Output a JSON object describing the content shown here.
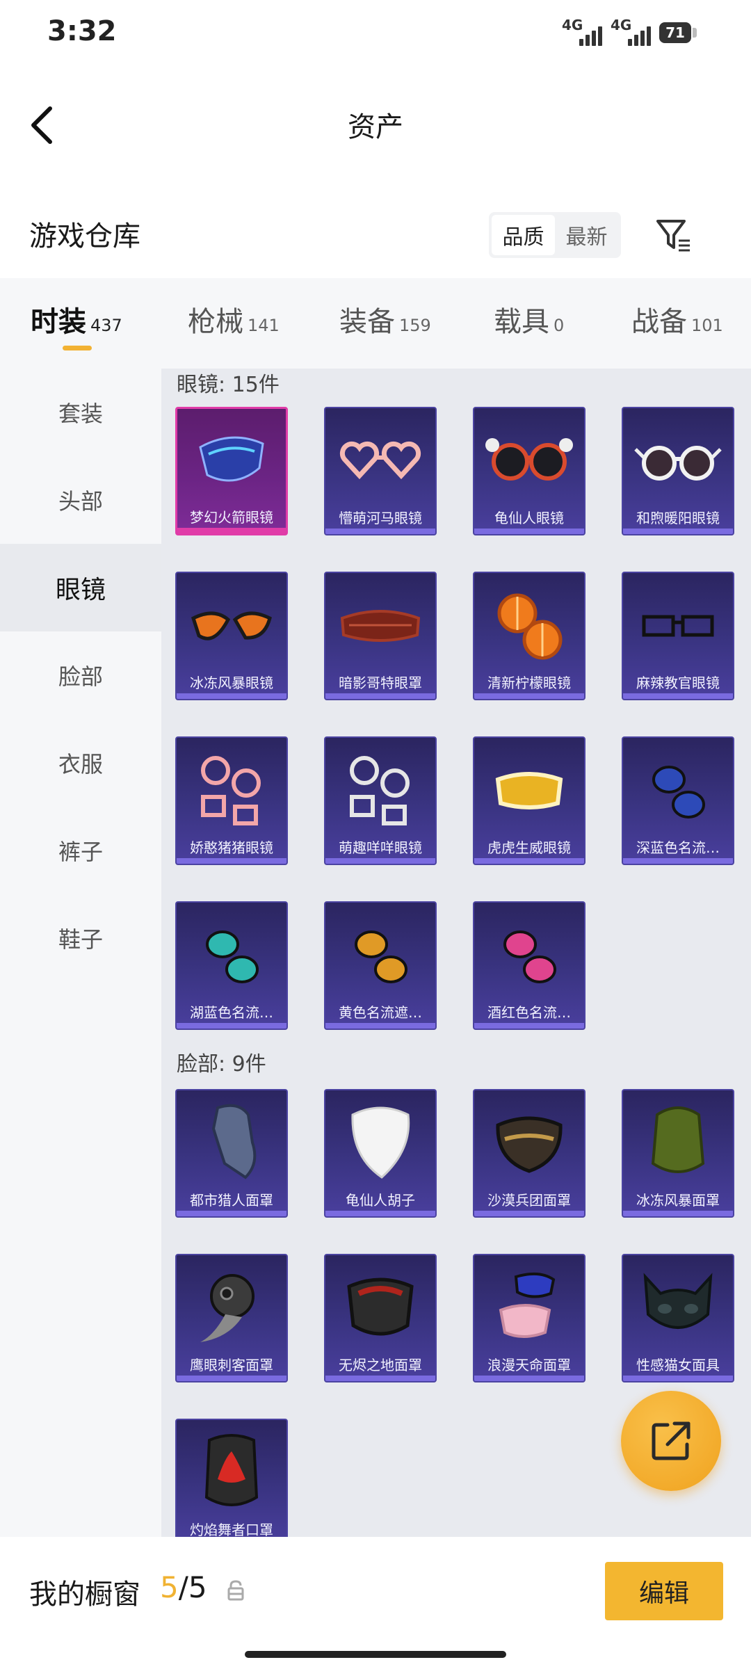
{
  "status_bar": {
    "time": "3:32",
    "network1": "4G",
    "network2": "4G",
    "battery": "71"
  },
  "header": {
    "title": "资产",
    "back_icon": "chevron-left-icon"
  },
  "warehouse": {
    "title": "游戏仓库",
    "sort_options": [
      "品质",
      "最新"
    ],
    "sort_selected": "品质",
    "filter_icon": "filter-icon"
  },
  "tabs": [
    {
      "label": "时装",
      "count": "437",
      "active": true
    },
    {
      "label": "枪械",
      "count": "141",
      "active": false
    },
    {
      "label": "装备",
      "count": "159",
      "active": false
    },
    {
      "label": "载具",
      "count": "0",
      "active": false
    },
    {
      "label": "战备",
      "count": "101",
      "active": false
    }
  ],
  "sidebar": {
    "items": [
      {
        "label": "套装",
        "active": false
      },
      {
        "label": "头部",
        "active": false
      },
      {
        "label": "眼镜",
        "active": true
      },
      {
        "label": "脸部",
        "active": false
      },
      {
        "label": "衣服",
        "active": false
      },
      {
        "label": "裤子",
        "active": false
      },
      {
        "label": "鞋子",
        "active": false
      }
    ]
  },
  "sections": [
    {
      "title": "眼镜: 15件",
      "items": [
        {
          "name": "梦幻火箭眼镜",
          "selected": true,
          "icon": "visor-icon"
        },
        {
          "name": "懵萌河马眼镜",
          "icon": "heart-glasses-icon"
        },
        {
          "name": "龟仙人眼镜",
          "icon": "sunglasses-icon"
        },
        {
          "name": "和煦暖阳眼镜",
          "icon": "sunglasses-icon"
        },
        {
          "name": "冰冻风暴眼镜",
          "icon": "goggles-icon"
        },
        {
          "name": "暗影哥特眼罩",
          "icon": "eye-mask-icon"
        },
        {
          "name": "清新柠檬眼镜",
          "icon": "lemon-glasses-icon"
        },
        {
          "name": "麻辣教官眼镜",
          "icon": "rect-glasses-icon"
        },
        {
          "name": "娇憨猪猪眼镜",
          "icon": "round-glasses-icon"
        },
        {
          "name": "萌趣咩咩眼镜",
          "icon": "round-glasses-icon"
        },
        {
          "name": "虎虎生威眼镜",
          "icon": "ski-goggles-icon"
        },
        {
          "name": "深蓝色名流…",
          "icon": "sunglasses-icon"
        },
        {
          "name": "湖蓝色名流…",
          "icon": "sunglasses-icon"
        },
        {
          "name": "黄色名流遮…",
          "icon": "sunglasses-icon"
        },
        {
          "name": "酒红色名流…",
          "icon": "sunglasses-icon"
        }
      ]
    },
    {
      "title": "脸部: 9件",
      "items": [
        {
          "name": "都市猎人面罩",
          "icon": "bandana-mask-icon"
        },
        {
          "name": "龟仙人胡子",
          "icon": "beard-icon"
        },
        {
          "name": "沙漠兵团面罩",
          "icon": "face-mask-icon"
        },
        {
          "name": "冰冻风暴面罩",
          "icon": "neck-gaiter-icon"
        },
        {
          "name": "鹰眼刺客面罩",
          "icon": "plague-mask-icon"
        },
        {
          "name": "无烬之地面罩",
          "icon": "respirator-icon"
        },
        {
          "name": "浪漫天命面罩",
          "icon": "face-mask-icon"
        },
        {
          "name": "性感猫女面具",
          "icon": "cat-mask-icon"
        },
        {
          "name": "灼焰舞者口罩",
          "icon": "flame-gaiter-icon"
        }
      ]
    }
  ],
  "bottom_bar": {
    "label": "我的橱窗",
    "count_current": "5",
    "count_sep_total": "/5",
    "lock_icon": "lock-icon",
    "edit_label": "编辑"
  },
  "colors": {
    "accent": "#f2b233",
    "card_bg": "#3a3482",
    "selected_border": "#e03ca8"
  }
}
